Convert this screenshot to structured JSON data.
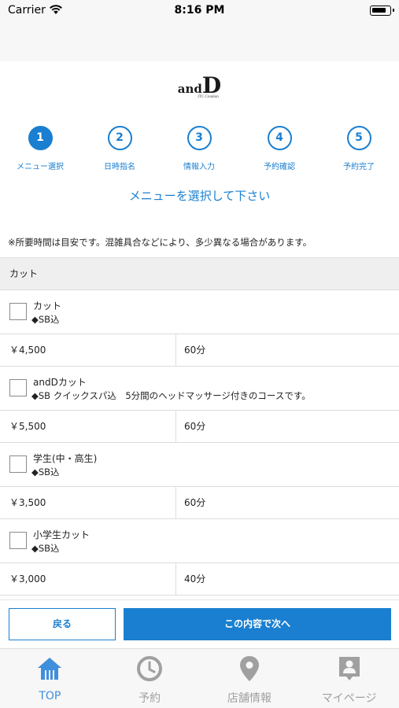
{
  "status_bar": {
    "carrier": "Carrier",
    "time": "8:16 PM"
  },
  "logo": {
    "prefix": "and",
    "big_letter": "D",
    "subtitle": "ITC Creation"
  },
  "steps": [
    {
      "number": "1",
      "label": "メニュー選択",
      "active": true
    },
    {
      "number": "2",
      "label": "日時指名",
      "active": false
    },
    {
      "number": "3",
      "label": "情報入力",
      "active": false
    },
    {
      "number": "4",
      "label": "予約確認",
      "active": false
    },
    {
      "number": "5",
      "label": "予約完了",
      "active": false
    }
  ],
  "instruction": "メニューを選択して下さい",
  "note": "※所要時間は目安です。混雑具合などにより、多少異なる場合があります。",
  "section": {
    "title": "カット"
  },
  "menu_items": [
    {
      "name": "カット",
      "description": "◆SB込",
      "price": "￥4,500",
      "duration": "60分",
      "checked": false
    },
    {
      "name": "andDカット",
      "description": "◆SB クイックスパ込　5分間のヘッドマッサージ付きのコースです。",
      "price": "￥5,500",
      "duration": "60分",
      "checked": false
    },
    {
      "name": "学生(中・高生)",
      "description": "◆SB込",
      "price": "￥3,500",
      "duration": "60分",
      "checked": false
    },
    {
      "name": "小学生カット",
      "description": "◆SB込",
      "price": "￥3,000",
      "duration": "40分",
      "checked": false
    }
  ],
  "actions": {
    "back_label": "戻る",
    "next_label": "この内容で次へ"
  },
  "tab_bar": {
    "items": [
      {
        "label": "TOP",
        "icon": "home-icon",
        "active": true
      },
      {
        "label": "予約",
        "icon": "clock-icon",
        "active": false
      },
      {
        "label": "店舗情報",
        "icon": "map-pin-icon",
        "active": false
      },
      {
        "label": "マイページ",
        "icon": "profile-icon",
        "active": false
      }
    ]
  },
  "colors": {
    "accent": "#1a7fd0",
    "tab_active": "#3f8fdc",
    "tab_inactive": "#a0a0a0"
  }
}
